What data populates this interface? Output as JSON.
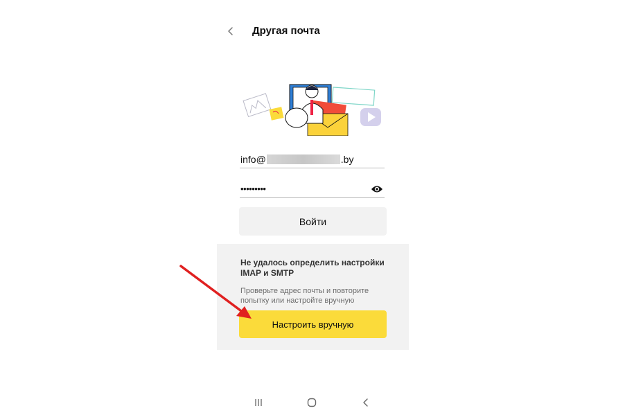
{
  "header": {
    "title": "Другая почта",
    "back_icon": "chevron-left-icon"
  },
  "form": {
    "email_prefix": "info@",
    "email_suffix": ".by",
    "password_masked": "•••••••••",
    "password_visibility_icon": "eye-icon",
    "login_label": "Войти"
  },
  "notice": {
    "title": "Не удалось определить настройки IMAP и SMTP",
    "text": "Проверьте адрес почты и повторите попытку или настройте вручную",
    "manual_setup_label": "Настроить вручную"
  },
  "annotation": {
    "arrow_color": "#e02020"
  },
  "navbar": {
    "recents_icon": "recents-icon",
    "home_icon": "home-icon",
    "back_icon": "back-icon"
  },
  "colors": {
    "accent_yellow": "#fbdb3a",
    "panel_gray": "#f2f2f2"
  }
}
